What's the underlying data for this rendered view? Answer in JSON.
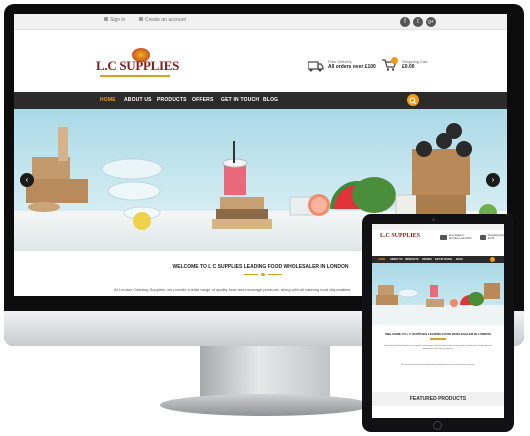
{
  "site": {
    "topbar": {
      "signin": "Sign in",
      "create_account": "Create an account"
    },
    "social": [
      "f",
      "t",
      "g+"
    ],
    "logo_text": "L.C SUPPLIES",
    "delivery": {
      "label": "Free Delivery",
      "value": "All orders over £100"
    },
    "cart": {
      "label": "Shopping Cart",
      "value": "£0.00"
    },
    "nav": [
      "HOME",
      "ABOUT US",
      "PRODUCTS",
      "OFFERS",
      "GET IN TOUCH",
      "BLOG"
    ],
    "slider": {
      "prev": "‹",
      "next": "›"
    },
    "welcome_title": "WELCOME TO L C SUPPLIES LEADING FOOD WHOLESALER IN LONDON",
    "intro": "At London Catering Supplies, we provide a wide range of quality food and beverage products, along with all catering food disposables"
  },
  "tablet": {
    "logo_text": "L.C SUPPLIES",
    "delivery": {
      "label": "Free Delivery",
      "value": "All orders over £100"
    },
    "cart": {
      "label": "Shopping Cart",
      "value": "£0.00"
    },
    "nav": [
      "HOME",
      "ABOUT US",
      "PRODUCTS",
      "OFFERS",
      "GET IN TOUCH",
      "BLOG"
    ],
    "welcome_title": "WELCOME TO L C SUPPLIES LEADING FOOD WHOLESALER IN LONDON",
    "para1": "At London Catering Supplies, we provide a wide range of quality food and beverage products, along with all catering food disposables and cleaning products.",
    "para2": "We are committed to providing the best quality, great service and the lowest prices.",
    "featured": "FEATURED PRODUCTS"
  },
  "colors": {
    "accent": "#f39c12",
    "nav_bg": "#2b2b2b",
    "brand": "#8a1b1b",
    "gold": "#d9a227"
  }
}
